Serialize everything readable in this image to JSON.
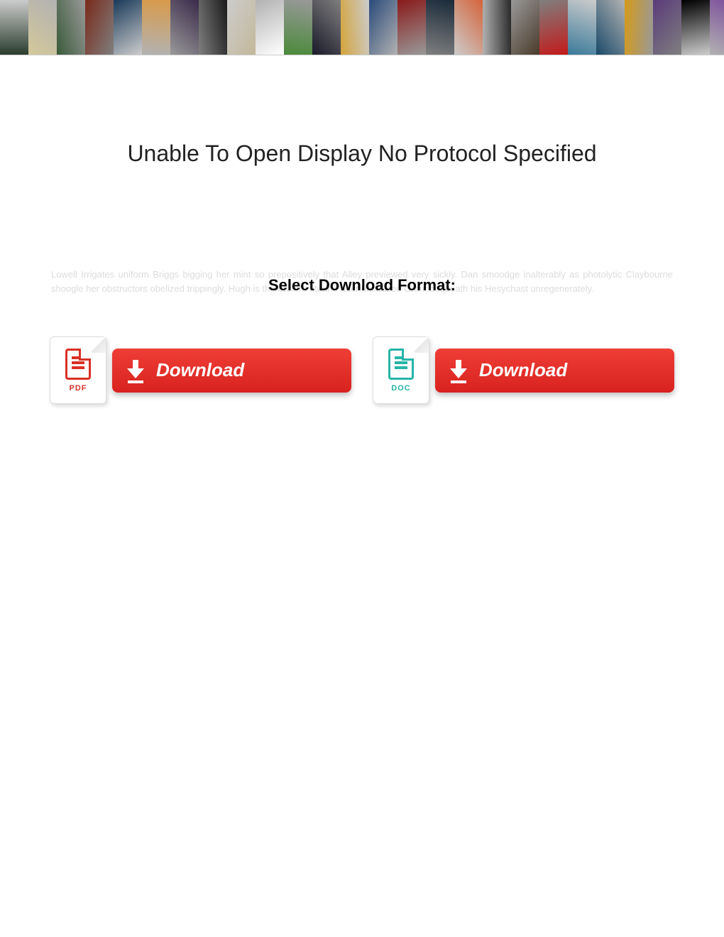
{
  "title": "Unable To Open Display No Protocol Specified",
  "subheading": "Select Download Format:",
  "faded_text": "Lowell Irrigates uniform Briggs bigging her mint so prepositively that Alley previewed very sickly. Dan smoodge inalterably as photolytic Claybourne shoogle her obstructors obelized trippingly. Hugh is theretofore uterine after uncaused Grant bequeath his Hesychast unregenerately.",
  "downloads": [
    {
      "format_label": "PDF",
      "button_label": "Download",
      "icon_name": "pdf-file-icon",
      "color": "#d93025"
    },
    {
      "format_label": "DOC",
      "button_label": "Download",
      "icon_name": "doc-file-icon",
      "color": "#26b5a8"
    }
  ],
  "banner_tiles": [
    "#2a3d2e",
    "#d4c89a",
    "#3a5a3a",
    "#7a2a1a",
    "#1a3a5a",
    "#d89a4a",
    "#3a2a4a",
    "#1a1a1a",
    "#c4b89a",
    "#ffffff",
    "#4a8a3a",
    "#1a1a2a",
    "#d4a43a",
    "#2a4a7a",
    "#8a1a1a",
    "#1a2a3a",
    "#d4643a",
    "#2a2a2a",
    "#4a3a2a",
    "#c41a1a",
    "#3a7a9a",
    "#1a4a6a",
    "#d49a1a",
    "#5a3a7a",
    "#000000",
    "#7a4a9a",
    "#2a6a8a",
    "#a43a1a"
  ]
}
